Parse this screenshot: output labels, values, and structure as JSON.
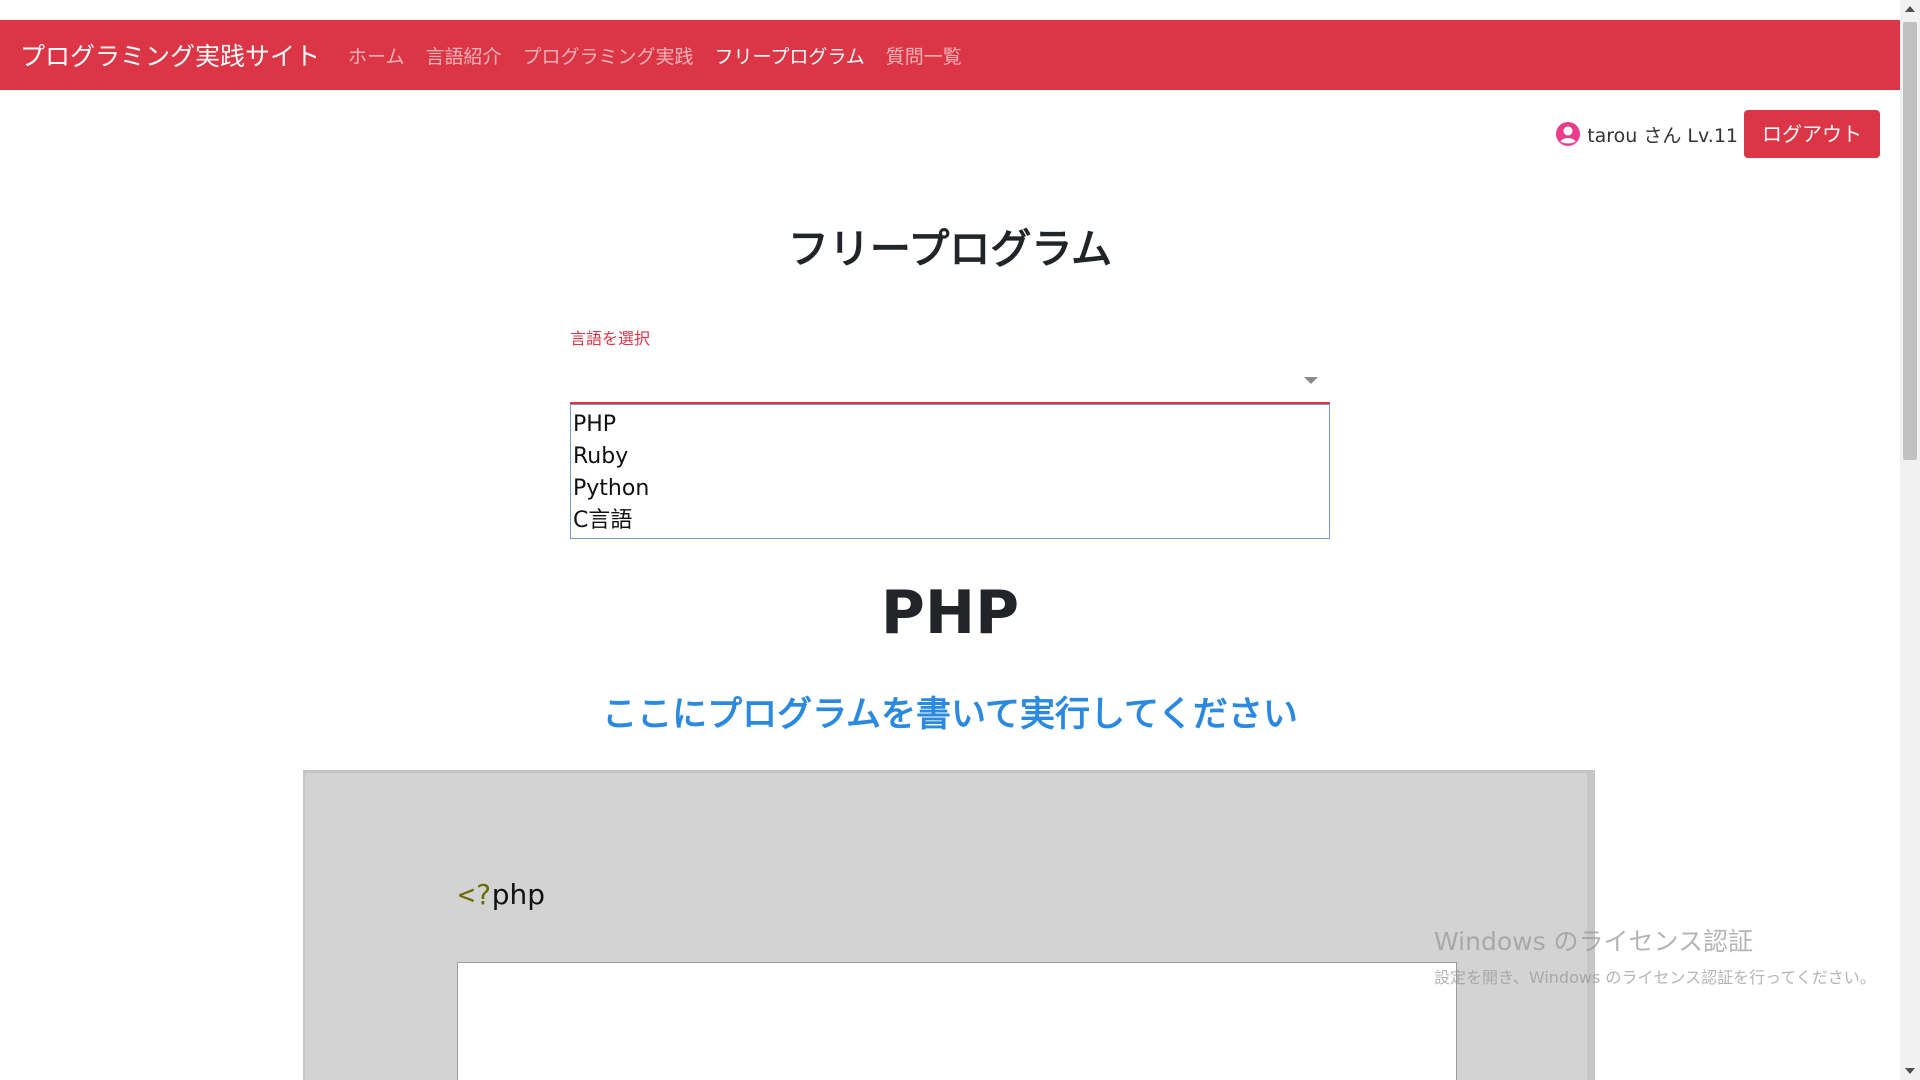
{
  "navbar": {
    "brand": "プログラミング実践サイト",
    "links": [
      {
        "label": "ホーム",
        "active": false
      },
      {
        "label": "言語紹介",
        "active": false
      },
      {
        "label": "プログラミング実践",
        "active": false
      },
      {
        "label": "フリープログラム",
        "active": true
      },
      {
        "label": "質問一覧",
        "active": false
      }
    ],
    "color": "#dc3545"
  },
  "user": {
    "icon": "user-circle-icon",
    "icon_color": "#e83e8c",
    "text": "tarou さん Lv.11",
    "logout_label": "ログアウト"
  },
  "main": {
    "title": "フリープログラム",
    "select": {
      "label": "言語を選択",
      "value": "",
      "options": [
        "PHP",
        "Ruby",
        "Python",
        "C言語"
      ]
    },
    "language_heading": "PHP",
    "instruction": "ここにプログラムを書いて実行してください",
    "instruction_color": "#2b89e0",
    "code": {
      "open_lt": "<?",
      "open_word": "php",
      "editor_value": ""
    }
  },
  "watermark": {
    "title": "Windows のライセンス認証",
    "subtitle": "設定を開き、Windows のライセンス認証を行ってください。"
  }
}
